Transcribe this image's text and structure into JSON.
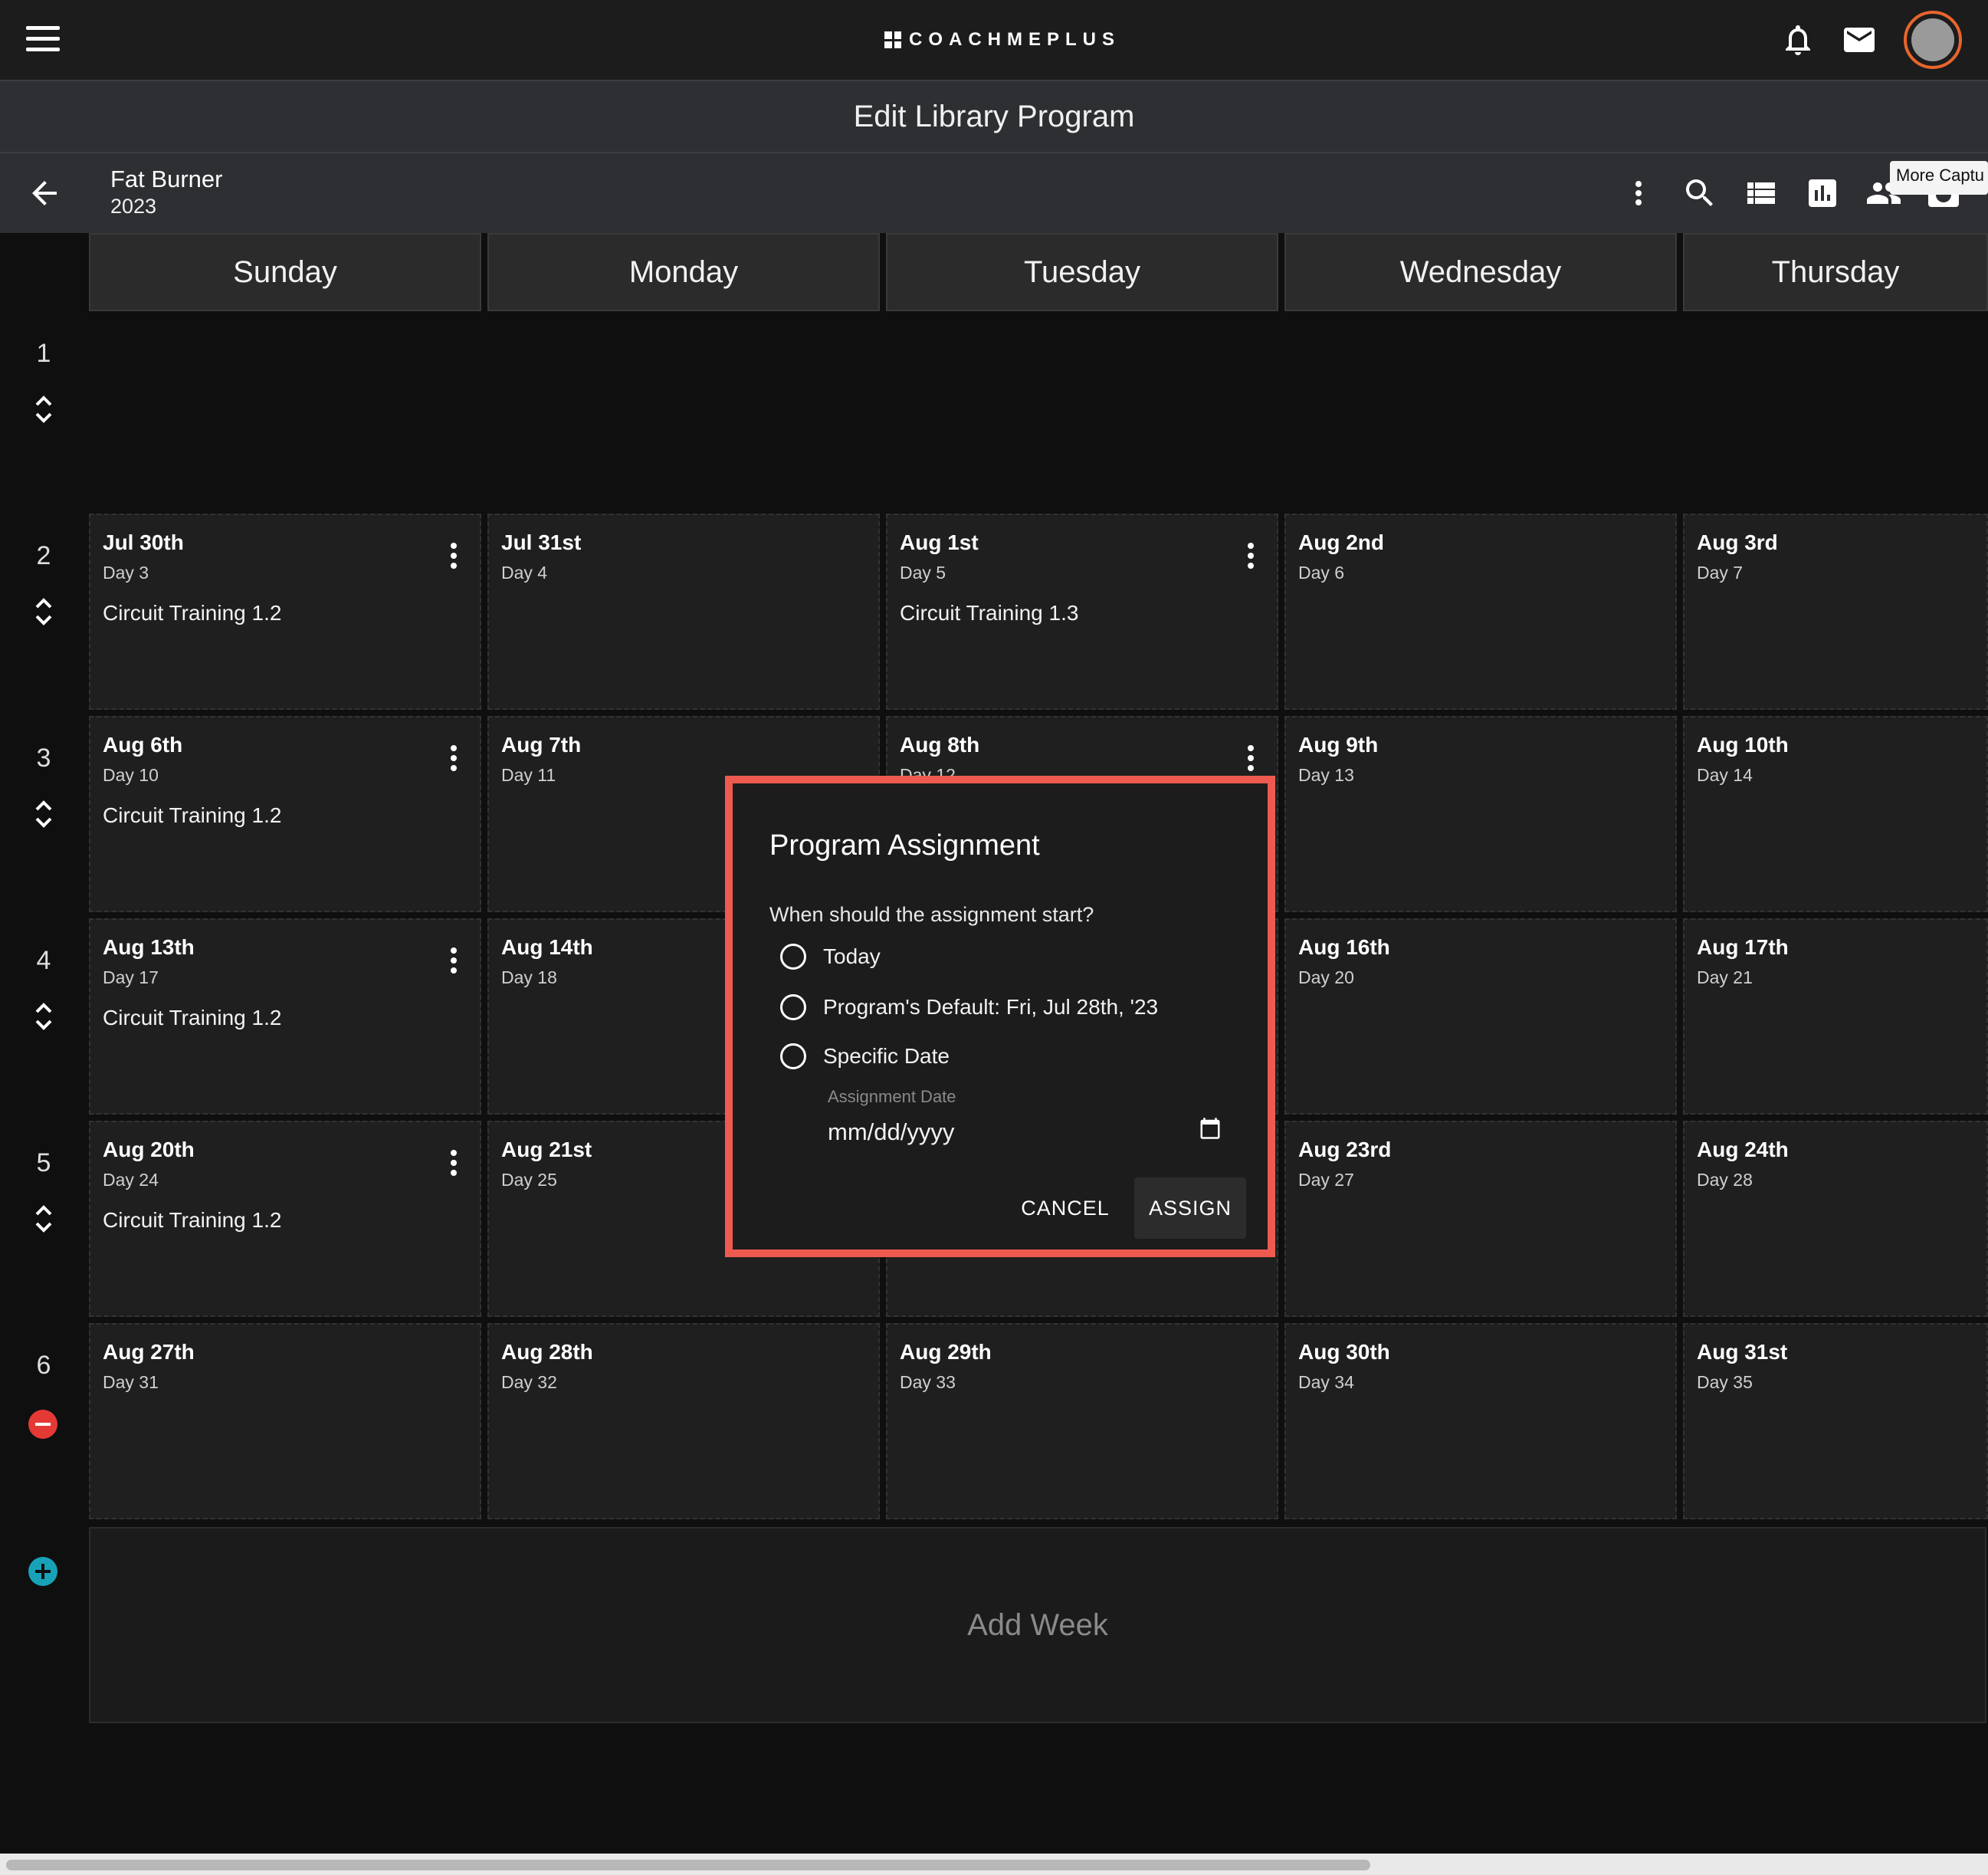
{
  "app": {
    "brand": "COACHMEPLUS"
  },
  "header": {
    "icons": [
      "menu-icon",
      "bell-icon",
      "mail-icon",
      "avatar"
    ],
    "page_title": "Edit Library Program"
  },
  "program": {
    "name": "Fat Burner",
    "year": "2023",
    "toolbar_icons": [
      "more-vert-icon",
      "search-icon",
      "list-icon",
      "chart-icon",
      "people-icon",
      "camera-icon"
    ],
    "tooltip": "More Captu"
  },
  "calendar": {
    "days": [
      "Sunday",
      "Monday",
      "Tuesday",
      "Wednesday",
      "Thursday"
    ],
    "weeks": [
      {
        "num": "1",
        "cells": []
      },
      {
        "num": "2",
        "cells": [
          {
            "date": "Jul 30th",
            "day": "Day 3",
            "workout": "Circuit Training 1.2",
            "menu": true
          },
          {
            "date": "Jul 31st",
            "day": "Day 4",
            "workout": "",
            "menu": false
          },
          {
            "date": "Aug 1st",
            "day": "Day 5",
            "workout": "Circuit Training 1.3",
            "menu": true
          },
          {
            "date": "Aug 2nd",
            "day": "Day 6",
            "workout": "",
            "menu": false
          },
          {
            "date": "Aug 3rd",
            "day": "Day 7",
            "workout": "",
            "menu": false
          }
        ]
      },
      {
        "num": "3",
        "cells": [
          {
            "date": "Aug 6th",
            "day": "Day 10",
            "workout": "Circuit Training 1.2",
            "menu": true
          },
          {
            "date": "Aug 7th",
            "day": "Day 11",
            "workout": "",
            "menu": false
          },
          {
            "date": "Aug 8th",
            "day": "Day 12",
            "workout": "",
            "menu": true
          },
          {
            "date": "Aug 9th",
            "day": "Day 13",
            "workout": "",
            "menu": false
          },
          {
            "date": "Aug 10th",
            "day": "Day 14",
            "workout": "",
            "menu": false
          }
        ]
      },
      {
        "num": "4",
        "cells": [
          {
            "date": "Aug 13th",
            "day": "Day 17",
            "workout": "Circuit Training 1.2",
            "menu": true
          },
          {
            "date": "Aug 14th",
            "day": "Day 18",
            "workout": "",
            "menu": false
          },
          {
            "date": "",
            "day": "",
            "workout": "",
            "menu": false
          },
          {
            "date": "Aug 16th",
            "day": "Day 20",
            "workout": "",
            "menu": false
          },
          {
            "date": "Aug 17th",
            "day": "Day 21",
            "workout": "",
            "menu": false
          }
        ]
      },
      {
        "num": "5",
        "cells": [
          {
            "date": "Aug 20th",
            "day": "Day 24",
            "workout": "Circuit Training 1.2",
            "menu": true
          },
          {
            "date": "Aug 21st",
            "day": "Day 25",
            "workout": "",
            "menu": false
          },
          {
            "date": "",
            "day": "",
            "workout": "",
            "menu": false
          },
          {
            "date": "Aug 23rd",
            "day": "Day 27",
            "workout": "",
            "menu": false
          },
          {
            "date": "Aug 24th",
            "day": "Day 28",
            "workout": "",
            "menu": false
          }
        ]
      },
      {
        "num": "6",
        "cells": [
          {
            "date": "Aug 27th",
            "day": "Day 31",
            "workout": "",
            "menu": false
          },
          {
            "date": "Aug 28th",
            "day": "Day 32",
            "workout": "",
            "menu": false
          },
          {
            "date": "Aug 29th",
            "day": "Day 33",
            "workout": "",
            "menu": false
          },
          {
            "date": "Aug 30th",
            "day": "Day 34",
            "workout": "",
            "menu": false
          },
          {
            "date": "Aug 31st",
            "day": "Day 35",
            "workout": "",
            "menu": false
          }
        ]
      }
    ],
    "add_week_label": "Add Week",
    "colors": {
      "remove_week": "#e53935",
      "add_week": "#17a2b8"
    }
  },
  "dialog": {
    "title": "Program Assignment",
    "question": "When should the assignment start?",
    "options": [
      "Today",
      "Program's Default: Fri, Jul 28th, '23",
      "Specific Date"
    ],
    "date_field_label": "Assignment Date",
    "date_placeholder": "mm/dd/yyyy",
    "cancel_label": "CANCEL",
    "assign_label": "ASSIGN",
    "highlight_color": "#ee5a4f"
  }
}
